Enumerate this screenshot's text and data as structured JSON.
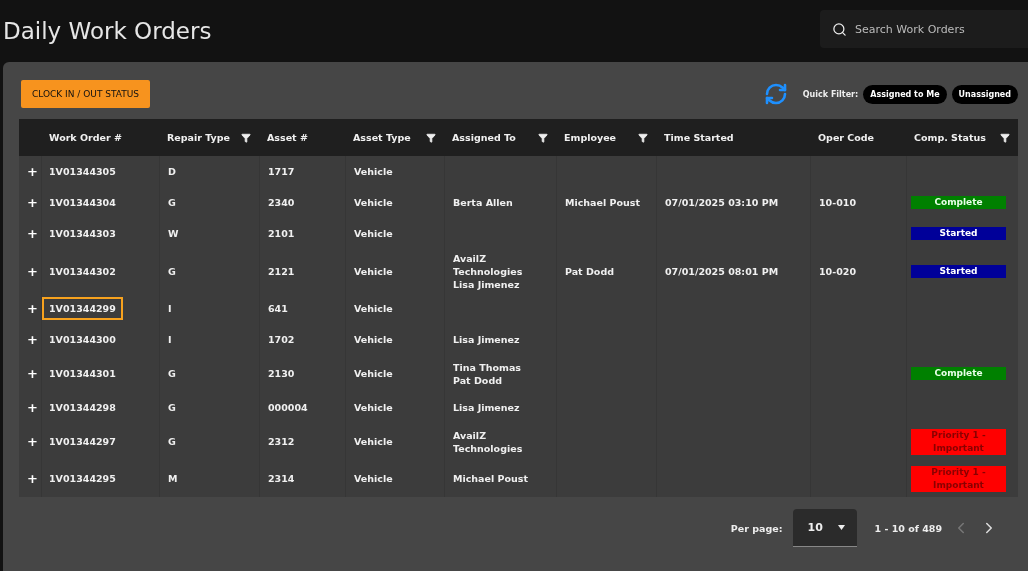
{
  "page_title": "Daily Work Orders",
  "search": {
    "placeholder": "Search Work Orders"
  },
  "clock_button": "CLOCK IN / OUT STATUS",
  "quick_filter": {
    "label": "Quick Filter:",
    "chips": [
      "Assigned to Me",
      "Unassigned"
    ]
  },
  "table": {
    "columns": [
      {
        "label": "Work Order #",
        "filter": false
      },
      {
        "label": "Repair Type",
        "filter": true
      },
      {
        "label": "Asset #",
        "filter": false
      },
      {
        "label": "Asset Type",
        "filter": true
      },
      {
        "label": "Assigned To",
        "filter": true
      },
      {
        "label": "Employee",
        "filter": true
      },
      {
        "label": "Time Started",
        "filter": false
      },
      {
        "label": "Oper Code",
        "filter": false
      },
      {
        "label": "Comp. Status",
        "filter": true
      }
    ],
    "rows": [
      {
        "expander": "+",
        "focused": false,
        "work_order": "1V01344305",
        "repair_type": "D",
        "asset": "1717",
        "asset_type": "Vehicle",
        "assigned_to": [],
        "employee": "",
        "time_started": "",
        "oper_code": ""
      },
      {
        "expander": "+",
        "focused": false,
        "work_order": "1V01344304",
        "repair_type": "G",
        "asset": "2340",
        "asset_type": "Vehicle",
        "assigned_to": [
          "Berta Allen"
        ],
        "employee": "Michael Poust",
        "time_started": "07/01/2025 03:10 PM",
        "oper_code": "10-010",
        "status": {
          "text": "Complete",
          "kind": "complete",
          "color": "#008000"
        }
      },
      {
        "expander": "+",
        "focused": false,
        "work_order": "1V01344303",
        "repair_type": "W",
        "asset": "2101",
        "asset_type": "Vehicle",
        "assigned_to": [],
        "employee": "",
        "time_started": "",
        "oper_code": "",
        "status": {
          "text": "Started",
          "kind": "started",
          "color": "#000099"
        }
      },
      {
        "expander": "+",
        "focused": false,
        "work_order": "1V01344302",
        "repair_type": "G",
        "asset": "2121",
        "asset_type": "Vehicle",
        "assigned_to": [
          "AvailZ Technologies",
          "Lisa Jimenez"
        ],
        "employee": "Pat Dodd",
        "time_started": "07/01/2025 08:01 PM",
        "oper_code": "10-020",
        "status": {
          "text": "Started",
          "kind": "started",
          "color": "#000099"
        }
      },
      {
        "expander": "+",
        "focused": true,
        "work_order": "1V01344299",
        "repair_type": "I",
        "asset": "641",
        "asset_type": "Vehicle",
        "assigned_to": [],
        "employee": "",
        "time_started": "",
        "oper_code": ""
      },
      {
        "expander": "+",
        "focused": false,
        "work_order": "1V01344300",
        "repair_type": "I",
        "asset": "1702",
        "asset_type": "Vehicle",
        "assigned_to": [
          "Lisa Jimenez"
        ],
        "employee": "",
        "time_started": "",
        "oper_code": ""
      },
      {
        "expander": "+",
        "focused": false,
        "work_order": "1V01344301",
        "repair_type": "G",
        "asset": "2130",
        "asset_type": "Vehicle",
        "assigned_to": [
          "Tina Thomas",
          "Pat Dodd"
        ],
        "employee": "",
        "time_started": "",
        "oper_code": "",
        "status": {
          "text": "Complete",
          "kind": "complete",
          "color": "#008000"
        }
      },
      {
        "expander": "+",
        "focused": false,
        "work_order": "1V01344298",
        "repair_type": "G",
        "asset": "000004",
        "asset_type": "Vehicle",
        "assigned_to": [
          "Lisa Jimenez"
        ],
        "employee": "",
        "time_started": "",
        "oper_code": ""
      },
      {
        "expander": "+",
        "focused": false,
        "work_order": "1V01344297",
        "repair_type": "G",
        "asset": "2312",
        "asset_type": "Vehicle",
        "assigned_to": [
          "AvailZ Technologies"
        ],
        "employee": "",
        "time_started": "",
        "oper_code": "",
        "status": {
          "text": "Priority 1 - Important",
          "kind": "priority",
          "color": "#ff0000"
        }
      },
      {
        "expander": "+",
        "focused": false,
        "work_order": "1V01344295",
        "repair_type": "M",
        "asset": "2314",
        "asset_type": "Vehicle",
        "assigned_to": [
          "Michael Poust"
        ],
        "employee": "",
        "time_started": "",
        "oper_code": "",
        "status": {
          "text": "Priority 1 - Important",
          "kind": "priority",
          "color": "#ff0000"
        }
      }
    ]
  },
  "pagination": {
    "per_page_label": "Per page:",
    "per_page": "10",
    "range": "1 - 10 of 489"
  }
}
